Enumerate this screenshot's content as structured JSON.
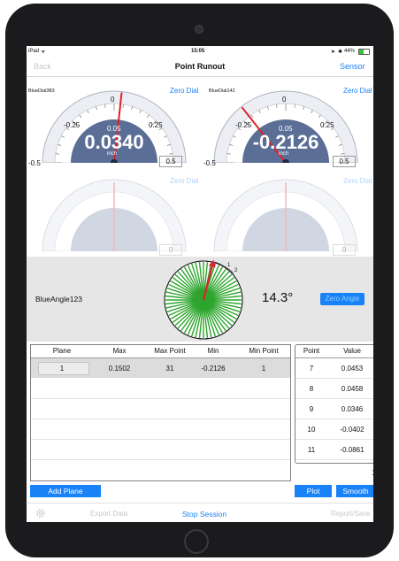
{
  "status_bar": {
    "device": "iPad",
    "wifi_glyph": "ᯤ",
    "time": "15:05",
    "battery": "44%"
  },
  "nav": {
    "back": "Back",
    "title": "Point Runout",
    "sensor": "Sensor"
  },
  "gauges": [
    {
      "name": "BlueDial383",
      "zero_label": "Zero Dial",
      "min": "-0.5",
      "max": "0.5",
      "tick_left": "-0.25",
      "tick_center": "0",
      "tick_right": "0.25",
      "small_value": "0.05",
      "value": "0.0340",
      "unit": "inch",
      "reading": 0.034
    },
    {
      "name": "BlueDial142",
      "zero_label": "Zero Dial",
      "min": "-0.5",
      "max": "0.5",
      "tick_left": "-0.25",
      "tick_center": "0",
      "tick_right": "0.25",
      "small_value": "0.05",
      "value": "-0.2126",
      "unit": "inch",
      "reading": -0.2126
    },
    {
      "zero_label": "Zero Dial",
      "right_value": "0"
    },
    {
      "zero_label": "Zero Dial",
      "right_value": "0"
    }
  ],
  "angle": {
    "name": "BlueAngle123",
    "value": "14.3°",
    "zero_label": "Zero Angle",
    "ticks": [
      "1",
      "2"
    ],
    "degrees": 14.3
  },
  "main_table": {
    "headers": [
      "Plane",
      "Max",
      "Max Point",
      "Min",
      "Min Point"
    ],
    "rows": [
      [
        "1",
        "0.1502",
        "31",
        "-0.2126",
        "1"
      ]
    ]
  },
  "point_table": {
    "headers": [
      "Point",
      "Value"
    ],
    "rows": [
      [
        "7",
        "0.0453"
      ],
      [
        "8",
        "0.0458"
      ],
      [
        "9",
        "0.0346"
      ],
      [
        "10",
        "-0.0402"
      ],
      [
        "11",
        "-0.0861"
      ]
    ]
  },
  "page_number": "1",
  "buttons": {
    "add_plane": "Add Plane",
    "plot": "Plot",
    "smooth": "Smooth"
  },
  "toolbar": {
    "export": "Export Data",
    "stop": "Stop Session",
    "report": "Report/Save"
  },
  "colors": {
    "accent": "#1a82f7",
    "needle": "#e0202a",
    "gauge_face": "#5a6e96",
    "wheel": "#2da52d"
  }
}
